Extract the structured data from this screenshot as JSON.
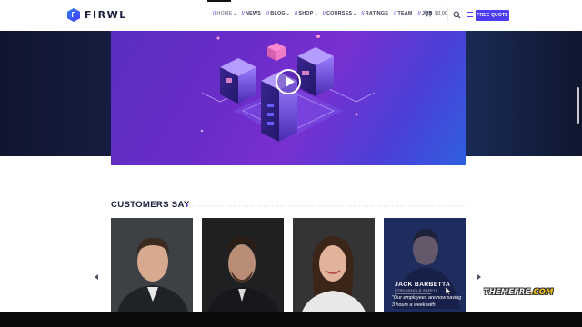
{
  "header": {
    "logo_letter": "F",
    "logo_text": "FIRWL",
    "nav": [
      {
        "label": "HOME",
        "dropdown": true,
        "active": true
      },
      {
        "label": "NEWS",
        "dropdown": false,
        "active": false
      },
      {
        "label": "BLOG",
        "dropdown": true,
        "active": false
      },
      {
        "label": "SHOP",
        "dropdown": true,
        "active": false
      },
      {
        "label": "COURSES",
        "dropdown": true,
        "active": false
      },
      {
        "label": "RATINGS",
        "dropdown": false,
        "active": false
      },
      {
        "label": "TEAM",
        "dropdown": false,
        "active": false
      },
      {
        "label": "JOB",
        "dropdown": false,
        "active": false
      }
    ],
    "cart_total": "$0.00",
    "cta_label": "FREE QUOTE"
  },
  "hero": {
    "video_icon": "play-icon"
  },
  "customers": {
    "title": "CUSTOMERS SAY",
    "featured": {
      "name": "JACK BARBETTA",
      "role": "STRONGHOLD SAFETY",
      "quote": "\"Our employees are now saving 3 hours a week with"
    }
  },
  "watermark": {
    "main": "THEMEFRE",
    "tld": ".COM"
  },
  "colors": {
    "accent": "#4a3cf0",
    "hero_purple": "#6a2cc8",
    "dark_navy": "#1a1f3a"
  }
}
